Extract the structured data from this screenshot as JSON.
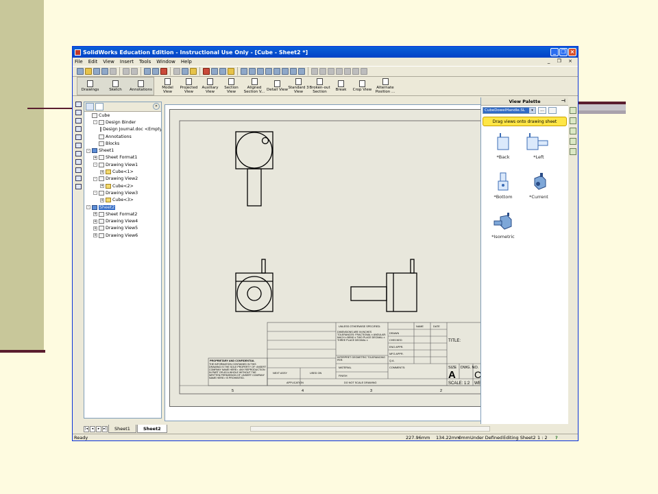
{
  "window": {
    "title": "SolidWorks Education Edition - Instructional Use Only - [Cube - Sheet2 *]"
  },
  "menu": [
    "File",
    "Edit",
    "View",
    "Insert",
    "Tools",
    "Window",
    "Help"
  ],
  "command_manager": {
    "left_group": [
      "Drawings",
      "Sketch",
      "Annotations"
    ],
    "commands": [
      "Model View",
      "Projected View",
      "Auxiliary View",
      "Section View",
      "Aligned Section V...",
      "Detail View",
      "Standard 3 View",
      "Broken-out Section",
      "Break",
      "Crop View",
      "Alternate Position ..."
    ]
  },
  "tree": {
    "nodes": [
      {
        "label": "Cube",
        "indent": 0,
        "exp": ""
      },
      {
        "label": "Design Binder",
        "indent": 1,
        "exp": "-"
      },
      {
        "label": "Design Journal.doc <Empty>",
        "indent": 2,
        "exp": ""
      },
      {
        "label": "Annotations",
        "indent": 1,
        "exp": ""
      },
      {
        "label": "Blocks",
        "indent": 1,
        "exp": ""
      },
      {
        "label": "Sheet1",
        "indent": 0,
        "exp": "-"
      },
      {
        "label": "Sheet Format1",
        "indent": 1,
        "exp": "+"
      },
      {
        "label": "Drawing View1",
        "indent": 1,
        "exp": "-"
      },
      {
        "label": "Cube<1>",
        "indent": 2,
        "exp": "+"
      },
      {
        "label": "Drawing View2",
        "indent": 1,
        "exp": "-"
      },
      {
        "label": "Cube<2>",
        "indent": 2,
        "exp": "+"
      },
      {
        "label": "Drawing View3",
        "indent": 1,
        "exp": "-"
      },
      {
        "label": "Cube<3>",
        "indent": 2,
        "exp": "+"
      },
      {
        "label": "Sheet2",
        "indent": 0,
        "exp": "-",
        "selected": true
      },
      {
        "label": "Sheet Format2",
        "indent": 1,
        "exp": "+"
      },
      {
        "label": "Drawing View4",
        "indent": 1,
        "exp": "+"
      },
      {
        "label": "Drawing View5",
        "indent": 1,
        "exp": "+"
      },
      {
        "label": "Drawing View6",
        "indent": 1,
        "exp": "+"
      }
    ]
  },
  "sheet_tabs": [
    "Sheet1",
    "Sheet2"
  ],
  "palette": {
    "title": "View Palette",
    "file": "CubeDowelHandle.SL",
    "browse": "...",
    "tip": "Drag views onto drawing sheet",
    "views": [
      "*Back",
      "*Left",
      "*Bottom",
      "*Current",
      "*Isometric"
    ]
  },
  "title_block": {
    "unless": "UNLESS OTHERWISE SPECIFIED:",
    "name": "NAME",
    "date": "DATE",
    "dims": "DIMENSIONS ARE IN INCHES TOLERANCES: FRACTIONAL ± ANGULAR: MACH ± BEND ± TWO PLACE DECIMAL ± THREE PLACE DECIMAL ±",
    "drawn": "DRAWN",
    "checked": "CHECKED",
    "eng": "ENG APPR.",
    "mfg": "MFG APPR.",
    "qa": "Q.A.",
    "comments": "COMMENTS:",
    "interpret": "INTERPRET GEOMETRIC TOLERANCING PER:",
    "material": "MATERIAL",
    "finish": "FINISH",
    "next_assy": "NEXT ASSY",
    "used_on": "USED ON",
    "application": "APPLICATION",
    "do_not_scale": "DO NOT SCALE DRAWING",
    "proprietary": "PROPRIETARY AND CONFIDENTIAL",
    "prop_text": "THE INFORMATION CONTAINED IN THIS DRAWING IS THE SOLE PROPERTY OF <INSERT COMPANY NAME HERE>. ANY REPRODUCTION IN PART OR AS A WHOLE WITHOUT THE WRITTEN PERMISSION OF <INSERT COMPANY NAME HERE> IS PROHIBITED.",
    "title": "TITLE:",
    "size_label": "SIZE",
    "size": "A",
    "dwg_label": "DWG.  NO.",
    "dwg_no": "Cu",
    "scale": "SCALE: 1:2",
    "weight": "WEIGH"
  },
  "zone_numbers": [
    "5",
    "4",
    "3",
    "2"
  ],
  "status": {
    "ready": "Ready",
    "x": "227.96mm",
    "y": "134.22mm",
    "z": "0mm",
    "state": "Under Defined",
    "editing": "Editing Sheet2",
    "scale": "1 : 2",
    "help": "?"
  }
}
